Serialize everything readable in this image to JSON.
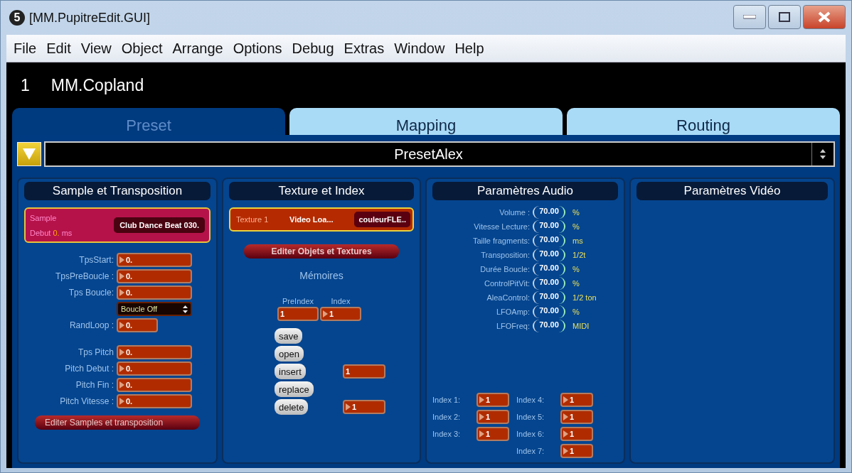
{
  "window": {
    "badge": "5",
    "title": "[MM.PupitreEdit.GUI]"
  },
  "menu": [
    "File",
    "Edit",
    "View",
    "Object",
    "Arrange",
    "Options",
    "Debug",
    "Extras",
    "Window",
    "Help"
  ],
  "header": {
    "number": "1",
    "name": "MM.Copland"
  },
  "tabs": [
    {
      "label": "Preset",
      "selected": true
    },
    {
      "label": "Mapping",
      "selected": false
    },
    {
      "label": "Routing",
      "selected": false
    }
  ],
  "preset": {
    "value": "PresetAlex"
  },
  "sample_panel": {
    "title": "Sample et Transposition",
    "sample": {
      "label": "Sample",
      "debut_label": "Debut",
      "debut_value": "0.",
      "debut_unit": "ms",
      "file": "Club Dance Beat 030."
    },
    "fields": [
      {
        "kind": "number",
        "label": "TpsStart:",
        "value": "0."
      },
      {
        "kind": "number",
        "label": "TpsPreBoucle :",
        "value": "0."
      },
      {
        "kind": "number",
        "label": "Tps Boucle:",
        "value": "0."
      },
      {
        "kind": "menu",
        "value": "Boucle Off"
      },
      {
        "kind": "short",
        "label": "RandLoop :",
        "value": "0."
      },
      {
        "kind": "gap"
      },
      {
        "kind": "number",
        "label": "Tps Pitch",
        "value": "0."
      },
      {
        "kind": "number",
        "label": "Pitch Debut :",
        "value": "0."
      },
      {
        "kind": "number",
        "label": "Pitch Fin :",
        "value": "0."
      },
      {
        "kind": "number",
        "label": "Pitch Vitesse :",
        "value": "0."
      }
    ],
    "button": "Editer Samples et transposition"
  },
  "texture_panel": {
    "title": "Texture et Index",
    "texture": {
      "label": "Texture 1",
      "name": "Video Loa...",
      "color_name": "couleurFLE.."
    },
    "button": "Editer Objets et Textures",
    "memories": "Mémoires",
    "preindex_label": "PreIndex",
    "index_label": "Index",
    "preindex": "1",
    "index": "1",
    "actions": [
      {
        "label": "save"
      },
      {
        "label": "open"
      },
      {
        "label": "insert",
        "value": "1",
        "kind": "plain"
      },
      {
        "label": "replace"
      },
      {
        "label": "delete",
        "value": "1",
        "kind": "arrow"
      }
    ]
  },
  "audio_panel": {
    "title": "Paramètres Audio",
    "params": [
      {
        "label": "Volume :",
        "value": "70.00",
        "unit": "%"
      },
      {
        "label": "Vitesse Lecture:",
        "value": "70.00",
        "unit": "%"
      },
      {
        "label": "Taille fragments:",
        "value": "70.00",
        "unit": "ms"
      },
      {
        "label": "Transposition:",
        "value": "70.00",
        "unit": "1/2t"
      },
      {
        "label": "Durée Boucle:",
        "value": "70.00",
        "unit": "%"
      },
      {
        "label": "ControlPitVit:",
        "value": "70.00",
        "unit": "%"
      },
      {
        "label": "AleaControl:",
        "value": "70.00",
        "unit": "1/2 ton"
      },
      {
        "label": "LFOAmp:",
        "value": "70.00",
        "unit": "%"
      },
      {
        "label": "LFOFreq:",
        "value": "70.00",
        "unit": "MIDI"
      }
    ],
    "index_left": [
      {
        "label": "Index 1:",
        "value": "1"
      },
      {
        "label": "Index 2:",
        "value": "1"
      },
      {
        "label": "Index 3:",
        "value": "1"
      }
    ],
    "index_right": [
      {
        "label": "Index 4:",
        "value": "1"
      },
      {
        "label": "Index 5:",
        "value": "1"
      },
      {
        "label": "Index 6:",
        "value": "1"
      },
      {
        "label": "Index 7:",
        "value": "1"
      }
    ]
  },
  "video_panel": {
    "title": "Paramètres Vidéo"
  }
}
